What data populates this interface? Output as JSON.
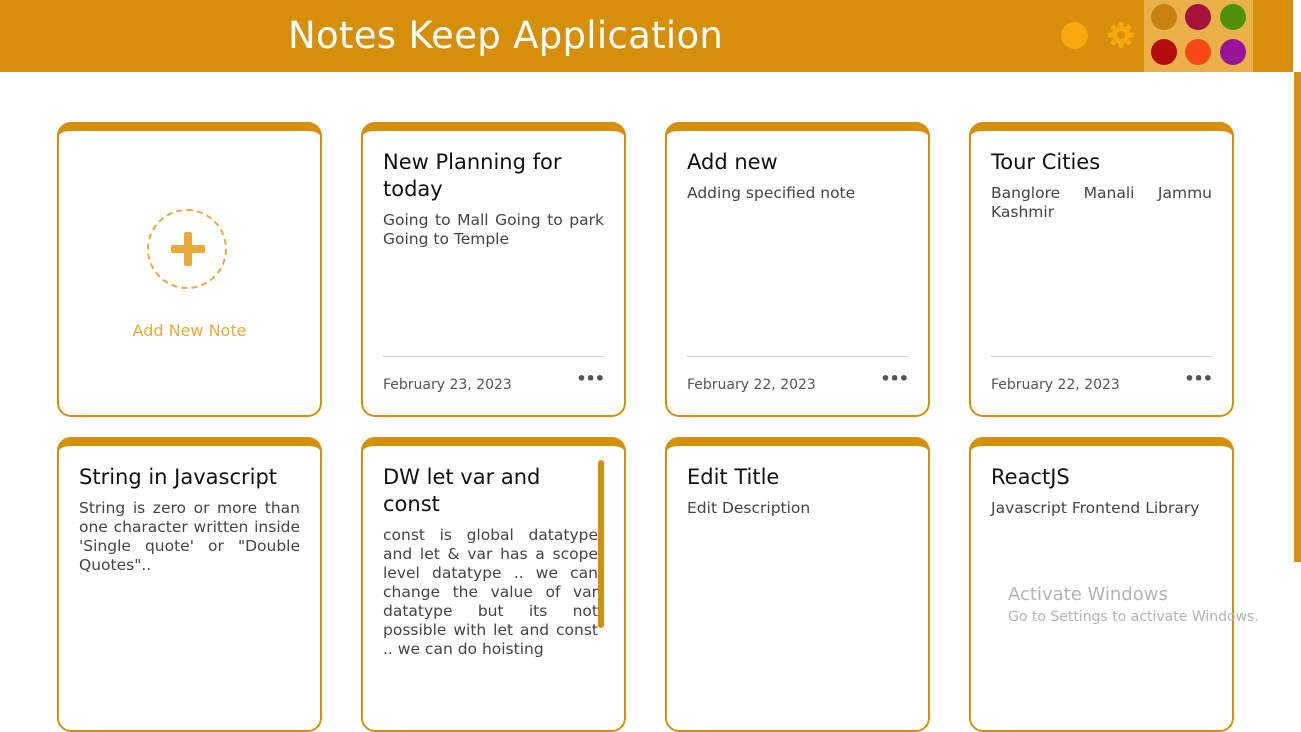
{
  "header": {
    "title": "Notes Keep Application",
    "background": "#d68f0b",
    "icons": {
      "theme_dot": "circle-icon",
      "settings": "gear-icon"
    },
    "palette": [
      "#c78110",
      "#a5133a",
      "#4d910b",
      "#b50c0c",
      "#f54a18",
      "#9a139b"
    ]
  },
  "add_note": {
    "label": "Add New Note",
    "icon": "plus-icon"
  },
  "notes": [
    {
      "title": "New Planning for today",
      "description": "Going to Mall Going to park Going to Temple",
      "date": "February 23, 2023"
    },
    {
      "title": "Add new",
      "description": "Adding specified note",
      "date": "February 22, 2023"
    },
    {
      "title": "Tour Cities",
      "description": "Banglore Manali Jammu Kashmir",
      "date": "February 22, 2023"
    },
    {
      "title": "String in Javascript",
      "description": "String is zero or more than one character written inside 'Single quote' or \"Double Quotes\"..",
      "date": ""
    },
    {
      "title": "DW let var and const",
      "description": "const is global datatype and let & var has a scope level datatype .. we can change the value of var datatype but its not possible with let and const .. we can do hoisting",
      "date": ""
    },
    {
      "title": "Edit Title",
      "description": "Edit Description",
      "date": ""
    },
    {
      "title": "ReactJS",
      "description": "Javascript Frontend Library",
      "date": ""
    }
  ],
  "card_menu_glyph": "•••",
  "watermark": {
    "line1": "Activate Windows",
    "line2": "Go to Settings to activate Windows."
  }
}
